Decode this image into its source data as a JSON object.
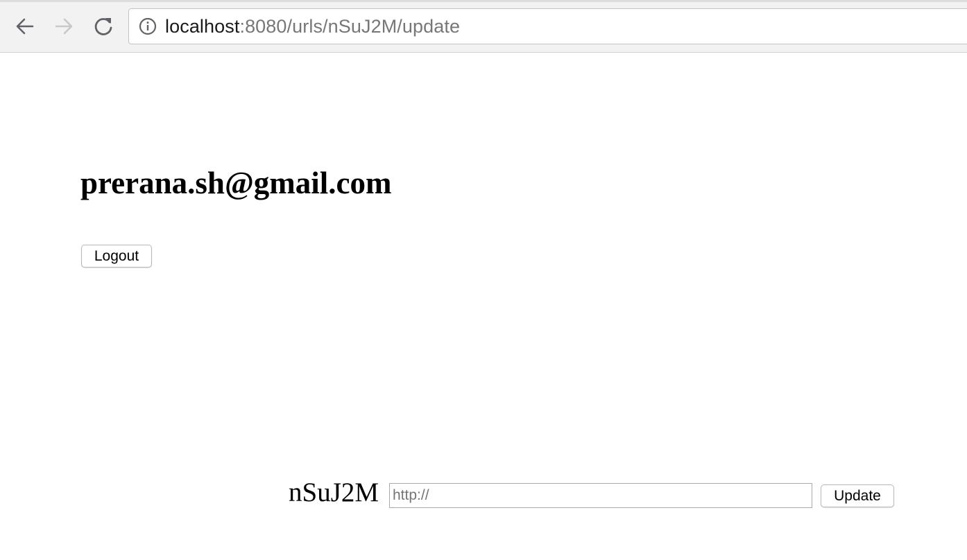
{
  "browser": {
    "url_host": "localhost",
    "url_rest": ":8080/urls/nSuJ2M/update"
  },
  "icons": {
    "back": "arrow-left-icon",
    "forward": "arrow-right-icon",
    "reload": "reload-icon",
    "info": "info-icon"
  },
  "colors": {
    "chrome_background": "#f2f2f2",
    "page_background": "#ffffff",
    "forward_disabled": "#c8c8c8"
  },
  "user": {
    "email": "prerana.sh@gmail.com"
  },
  "logout": {
    "label": "Logout"
  },
  "update_form": {
    "short_code": "nSuJ2M",
    "input_value": "",
    "input_placeholder": "http://",
    "button_label": "Update"
  }
}
